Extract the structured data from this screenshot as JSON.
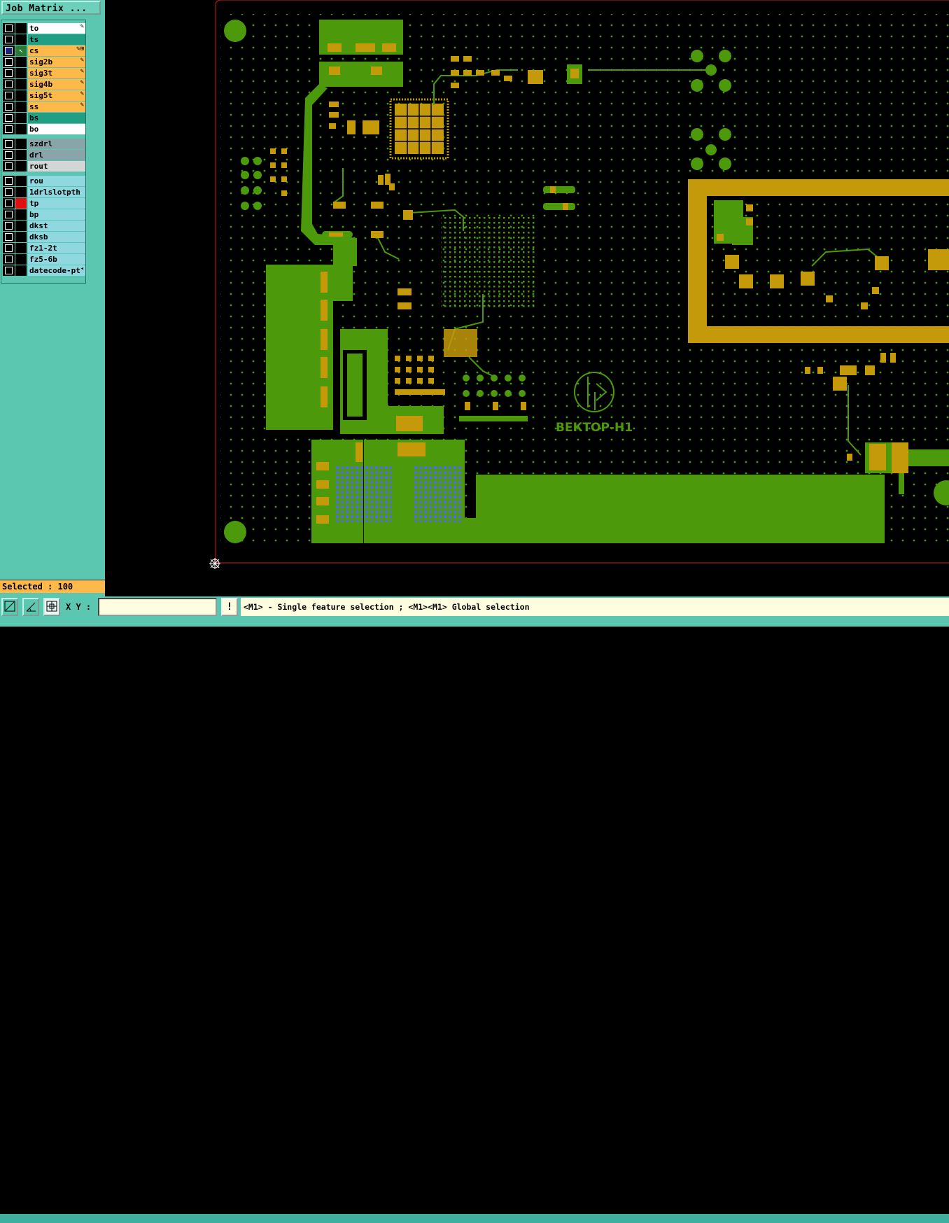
{
  "job_matrix": {
    "title": "Job Matrix ..."
  },
  "layers": [
    {
      "name": "to",
      "style": "white",
      "checked": false,
      "flag": "✎"
    },
    {
      "name": "ts",
      "style": "teal",
      "checked": false,
      "flag": ""
    },
    {
      "name": "cs",
      "style": "orange",
      "checked": true,
      "flag": "✎⊞",
      "active": true
    },
    {
      "name": "sig2b",
      "style": "orange",
      "checked": false,
      "flag": "✎"
    },
    {
      "name": "sig3t",
      "style": "orange",
      "checked": false,
      "flag": "✎"
    },
    {
      "name": "sig4b",
      "style": "orange",
      "checked": false,
      "flag": "✎"
    },
    {
      "name": "sig5t",
      "style": "orange",
      "checked": false,
      "flag": "✎"
    },
    {
      "name": "ss",
      "style": "orange",
      "checked": false,
      "flag": "✎"
    },
    {
      "name": "bs",
      "style": "teal",
      "checked": false,
      "flag": ""
    },
    {
      "name": "bo",
      "style": "white",
      "checked": false,
      "flag": ""
    },
    {
      "name": "szdrl",
      "style": "grey",
      "checked": false,
      "flag": ""
    },
    {
      "name": "drl",
      "style": "grey",
      "checked": false,
      "flag": ""
    },
    {
      "name": "rout",
      "style": "ltgrey",
      "checked": false,
      "flag": ""
    },
    {
      "name": "rou",
      "style": "cyan",
      "checked": false,
      "flag": ""
    },
    {
      "name": "1drlslotpth",
      "style": "cyan",
      "checked": false,
      "flag": ""
    },
    {
      "name": "tp",
      "style": "cyan",
      "checked": false,
      "flag": "",
      "red": true
    },
    {
      "name": "bp",
      "style": "cyan",
      "checked": false,
      "flag": ""
    },
    {
      "name": "dkst",
      "style": "cyan",
      "checked": false,
      "flag": ""
    },
    {
      "name": "dksb",
      "style": "cyan",
      "checked": false,
      "flag": ""
    },
    {
      "name": "fz1-2t",
      "style": "cyan",
      "checked": false,
      "flag": ""
    },
    {
      "name": "fz5-6b",
      "style": "cyan",
      "checked": false,
      "flag": ""
    },
    {
      "name": "datecode-pt",
      "style": "cyan",
      "checked": false,
      "flag": "◂"
    }
  ],
  "selected": {
    "text": "Selected : 100"
  },
  "bottom": {
    "xy_label": "X Y :",
    "xy_value": "",
    "hint": "<M1> - Single feature selection ; <M1><M1> Global selection",
    "warn": "!"
  },
  "board": {
    "silk_text": "ВЕКТОР-Н1",
    "colors": {
      "copper": "#c59a0a",
      "plane": "#4c9a0b",
      "via": "#39a000",
      "blue": "#4f6fe0",
      "outline": "#d02020"
    }
  },
  "icons": [
    "zoom-fit-icon",
    "measure-icon",
    "snap-grid-icon",
    "origin-crosshair-icon"
  ]
}
